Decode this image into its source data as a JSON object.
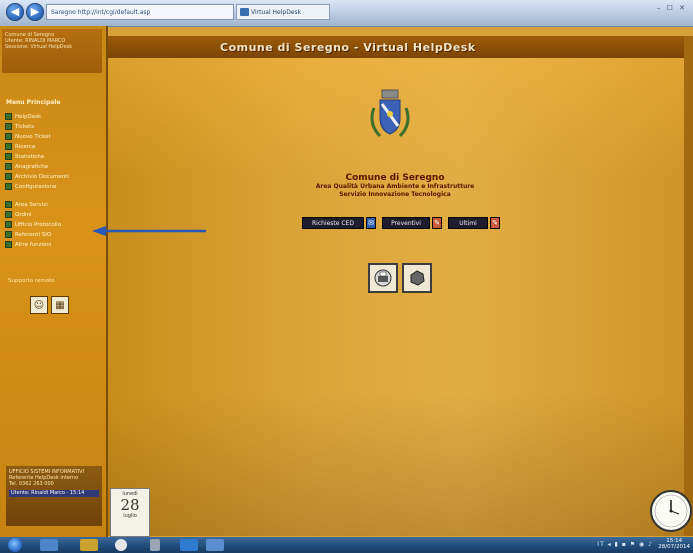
{
  "browser": {
    "address": "Saregno http://int/cgi/default.asp",
    "tab_label": "Virtual HelpDesk",
    "window_controls": "– ☐ ✕",
    "back_glyph": "◀",
    "forward_glyph": "▶"
  },
  "header": {
    "title": "Comune di Seregno - Virtual HelpDesk"
  },
  "sidebar": {
    "top_lines": [
      "Comune di Seregno",
      "Utente: RINALDI MARCO",
      "Sessione: Virtual HelpDesk"
    ],
    "section_title": "Menu Principale",
    "items_a": [
      {
        "label": "HelpDesk"
      },
      {
        "label": "Tickets"
      },
      {
        "label": "Nuovo Ticket"
      },
      {
        "label": "Ricerca"
      },
      {
        "label": "Statistiche"
      },
      {
        "label": "Anagrafiche"
      },
      {
        "label": "Archivio Documenti"
      },
      {
        "label": "Configurazione"
      }
    ],
    "items_b": [
      {
        "label": "Area Servizi"
      },
      {
        "label": "Ordini"
      },
      {
        "label": "Ufficio Protocollo"
      },
      {
        "label": "Referenti SIO"
      },
      {
        "label": "Altre funzioni"
      }
    ],
    "sub_label": "Supporto remoto",
    "footer_lines": [
      "UFFICIO SISTEMI INFORMATIVI",
      "Referente HelpDesk interno",
      "Tel. 0362 263 000"
    ],
    "footer_strip": "Utente: Rinaldi Marco - 15:14"
  },
  "main": {
    "title1": "Comune di Seregno",
    "title2": "Area Qualità Urbana Ambiente e Infrastrutture",
    "title3": "Servizio Innovazione Tecnologica",
    "buttons": [
      {
        "label": "Richieste CED",
        "icon_color": "#2f5fb0"
      },
      {
        "label": "Preventivi",
        "icon_color": "#c85a3a"
      },
      {
        "label": "Ultimi",
        "icon_color": "#c85a3a"
      }
    ]
  },
  "calendar": {
    "day": "lunedì",
    "date": "28",
    "month": "luglio"
  },
  "taskbar": {
    "clock_time": "15:14",
    "clock_date": "28/07/2014",
    "tray": "IT ◂ ▮ ▪ ⚑ ◉ ♪"
  },
  "colors": {
    "sidebar": "#d08e18",
    "main": "#dca53a",
    "header": "#8c5008"
  }
}
